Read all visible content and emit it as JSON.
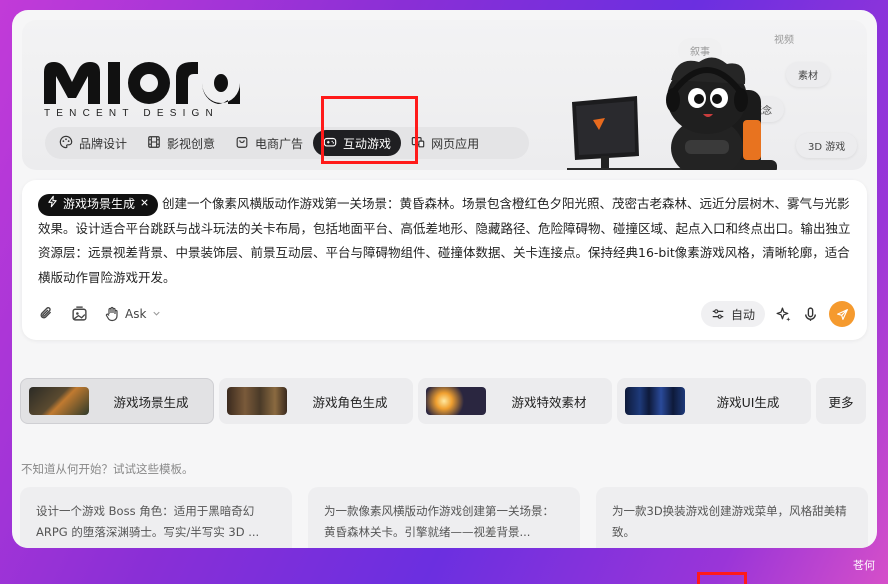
{
  "brand": {
    "name": "Miora",
    "tagline": "TENCENT DESIGN"
  },
  "tabs": [
    {
      "label": "品牌设计",
      "icon": "palette-icon"
    },
    {
      "label": "影视创意",
      "icon": "film-icon"
    },
    {
      "label": "电商广告",
      "icon": "shopping-bag-icon"
    },
    {
      "label": "互动游戏",
      "icon": "gamepad-icon",
      "active": true
    },
    {
      "label": "网页应用",
      "icon": "web-app-icon"
    }
  ],
  "floating_chips": {
    "narrative": "叙事",
    "video": "视频",
    "material": "素材",
    "concept": "概念",
    "game3d": "3D 游戏"
  },
  "prompt": {
    "tag": "游戏场景生成",
    "text": "创建一个像素风横版动作游戏第一关场景：黄昏森林。场景包含橙红色夕阳光照、茂密古老森林、远近分层树木、雾气与光影效果。设计适合平台跳跃与战斗玩法的关卡布局，包括地面平台、高低差地形、隐藏路径、危险障碍物、碰撞区域、起点入口和终点出口。输出独立资源层：远景视差背景、中景装饰层、前景互动层、平台与障碍物组件、碰撞体数据、关卡连接点。保持经典16-bit像素游戏风格，清晰轮廓，适合横版动作冒险游戏开发。"
  },
  "toolbar": {
    "mode_label": "Ask",
    "auto_label": "自动"
  },
  "quick_cards": [
    {
      "label": "游戏场景生成",
      "active": true
    },
    {
      "label": "游戏角色生成"
    },
    {
      "label": "游戏特效素材"
    },
    {
      "label": "游戏UI生成"
    }
  ],
  "more_label": "更多",
  "hint": "不知道从何开始？试试这些模板。",
  "templates": [
    {
      "text": "设计一个游戏 Boss 角色：适用于黑暗奇幻 ARPG 的堕落深渊骑士。写实/半写实 3D ..."
    },
    {
      "text": "为一款像素风横版动作游戏创建第一关场景：黄昏森林关卡。引擎就绪——视差背景..."
    },
    {
      "text": "为一款3D换装游戏创建游戏菜单，风格甜美精致。"
    }
  ],
  "corner_text": "苍何",
  "colors": {
    "accent": "#f59a2e",
    "active_tab": "#1f1f22",
    "highlight": "#ff1a1a"
  }
}
